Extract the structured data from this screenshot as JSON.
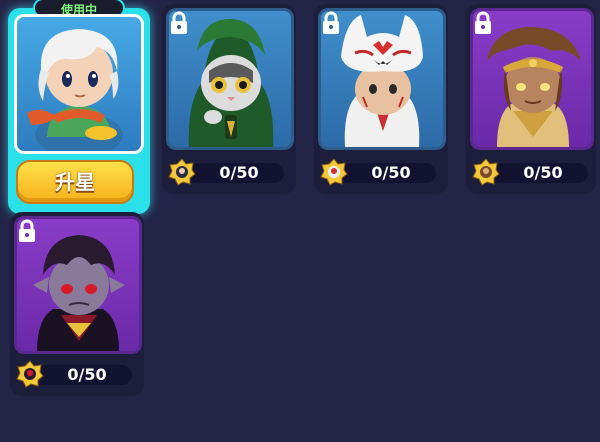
{
  "badge": {
    "in_use": "使用中"
  },
  "upgrade_button": {
    "label": "升星"
  },
  "characters": [
    {
      "id": "white-hair-hero",
      "locked": false,
      "selected": true,
      "theme": "blue"
    },
    {
      "id": "cat-hoodie",
      "locked": true,
      "selected": false,
      "theme": "blue",
      "progress": "0/50"
    },
    {
      "id": "fox-mask",
      "locked": true,
      "selected": false,
      "theme": "blue",
      "progress": "0/50"
    },
    {
      "id": "golden-warrior",
      "locked": true,
      "selected": false,
      "theme": "purple",
      "progress": "0/50"
    },
    {
      "id": "vampire",
      "locked": true,
      "selected": false,
      "theme": "purple",
      "progress": "0/50"
    }
  ],
  "icons": {
    "lock": "lock-icon",
    "fragment": "character-fragment-icon"
  },
  "colors": {
    "background": "#232547",
    "selected_border": "#2ce0ea",
    "badge_text": "#7df57a",
    "button_gold": "#f6b01a"
  }
}
